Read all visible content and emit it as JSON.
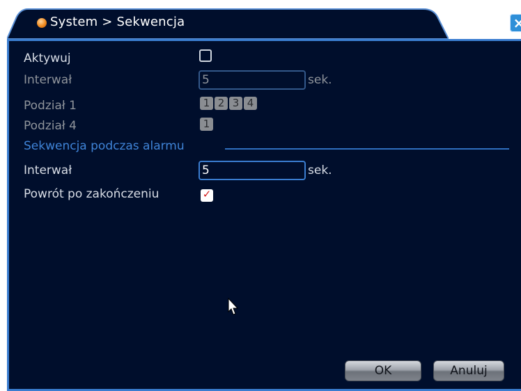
{
  "window": {
    "title": "System > Sekwencja",
    "close_symbol": "×",
    "title_icon": "orange-circle-icon",
    "close_icon": "close-icon"
  },
  "form": {
    "activate_label": "Aktywuj",
    "activate_checked": false,
    "interval_label": "Interwał",
    "interval_value": "5",
    "interval_unit": "sek.",
    "split1_label": "Podział 1",
    "split1_channels": [
      "1",
      "2",
      "3",
      "4"
    ],
    "split4_label": "Podział 4",
    "split4_channels": [
      "1"
    ]
  },
  "alarm_section": {
    "title": "Sekwencja podczas alarmu",
    "interval_label": "Interwał",
    "interval_value": "5",
    "interval_unit": "sek.",
    "return_label": "Powrót po zakończeniu",
    "return_checked": true,
    "check_symbol": "✓"
  },
  "buttons": {
    "ok_label": "OK",
    "cancel_label": "Anuluj"
  },
  "colors": {
    "panel_bg": "#000e2c",
    "accent": "#3a7dd0",
    "section_title": "#3f84d8"
  }
}
